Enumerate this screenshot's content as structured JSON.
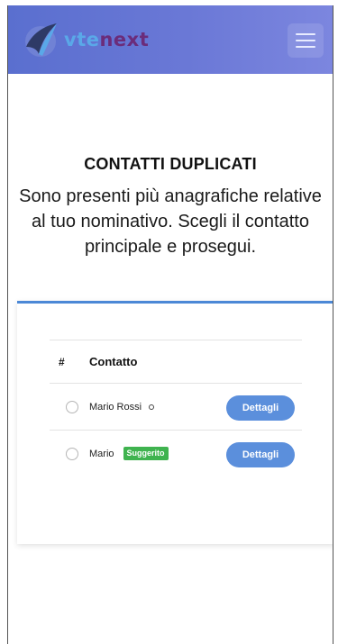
{
  "header": {
    "logo_part1": "vte",
    "logo_part2": "next",
    "logo_icon": "vtenext-logo-icon",
    "menu_icon": "hamburger-menu-icon"
  },
  "main": {
    "title": "CONTATTI DUPLICATI",
    "subtitle": "Sono presenti più anagrafiche relative al tuo nominativo. Scegli il contatto principale e prosegui."
  },
  "table": {
    "columns": [
      "#",
      "Contatto"
    ],
    "rows": [
      {
        "name": "Mario Rossi",
        "indicator": "circle-dot-icon",
        "badge": "",
        "button": "Dettagli"
      },
      {
        "name": "Mario",
        "indicator": "",
        "badge": "Suggerito",
        "button": "Dettagli"
      }
    ]
  },
  "colors": {
    "header_gradient_start": "#5a6fcf",
    "header_gradient_end": "#7c86df",
    "card_accent": "#4c88d6",
    "button": "#5b8fdc",
    "badge": "#3fb34f"
  }
}
